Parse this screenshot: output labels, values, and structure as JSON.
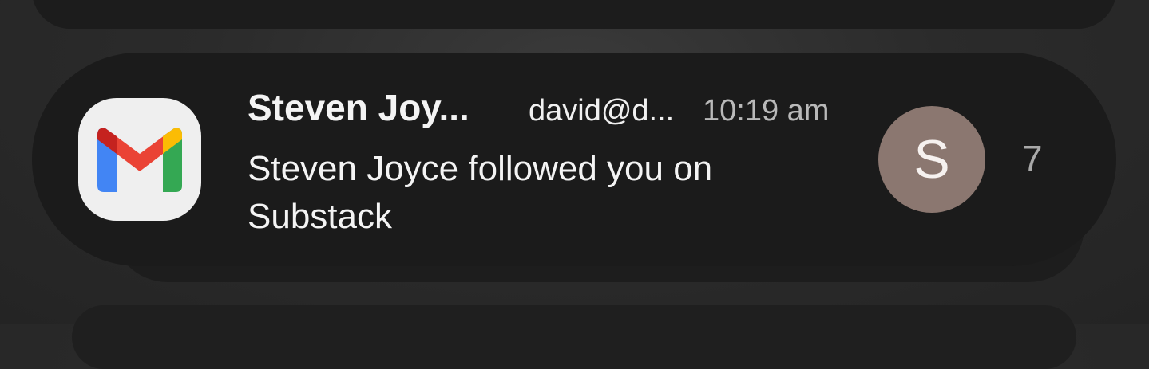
{
  "notification": {
    "app_icon": "gmail-icon",
    "sender": "Steven Joy...",
    "account": "david@d...",
    "time": "10:19 am",
    "message": "Steven Joyce followed you on Substack",
    "avatar_letter": "S",
    "count": "7"
  },
  "colors": {
    "background": "#2b2b2b",
    "card": "#1b1b1b",
    "avatar": "#8b7770",
    "gmail_red": "#EA4335",
    "gmail_blue": "#4285F4",
    "gmail_green": "#34A853",
    "gmail_yellow": "#FBBC04",
    "gmail_dark_red": "#C5221F"
  }
}
